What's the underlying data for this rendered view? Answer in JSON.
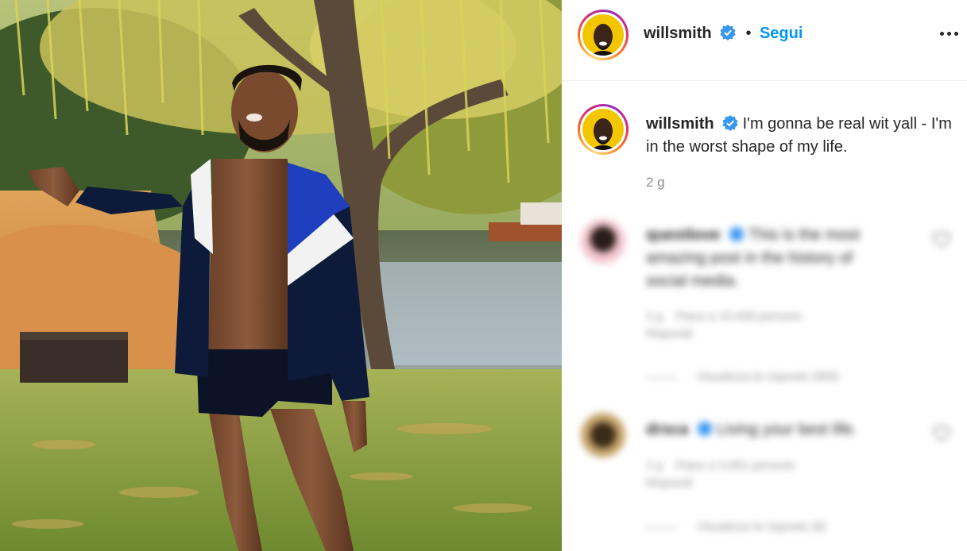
{
  "author": {
    "username": "willsmith",
    "follow_label": "Segui",
    "separator": "•"
  },
  "post": {
    "caption": "I'm gonna be real wit yall - I'm in the worst shape of my life.",
    "time_ago": "2 g"
  },
  "comments": [
    {
      "username": "questlove",
      "text": "This is the most amazing post in the history of social media.",
      "time": "2 g",
      "likes": "Piace a 15.938 persone",
      "reply_label": "Rispondi",
      "view_replies": "Visualizza le risposte (999)"
    },
    {
      "username": "drsca",
      "text": "Living your best life.",
      "time": "2 g",
      "likes": "Piace a 3.651 persone",
      "reply_label": "Rispondi",
      "view_replies": "Visualizza le risposte (8)"
    }
  ],
  "colors": {
    "accent": "#0095f6",
    "verified": "#3897f0",
    "text": "#262626",
    "muted": "#8e8e8e"
  },
  "icons": {
    "verified": "verified-badge-icon",
    "more": "more-options-icon",
    "like": "heart-icon"
  }
}
